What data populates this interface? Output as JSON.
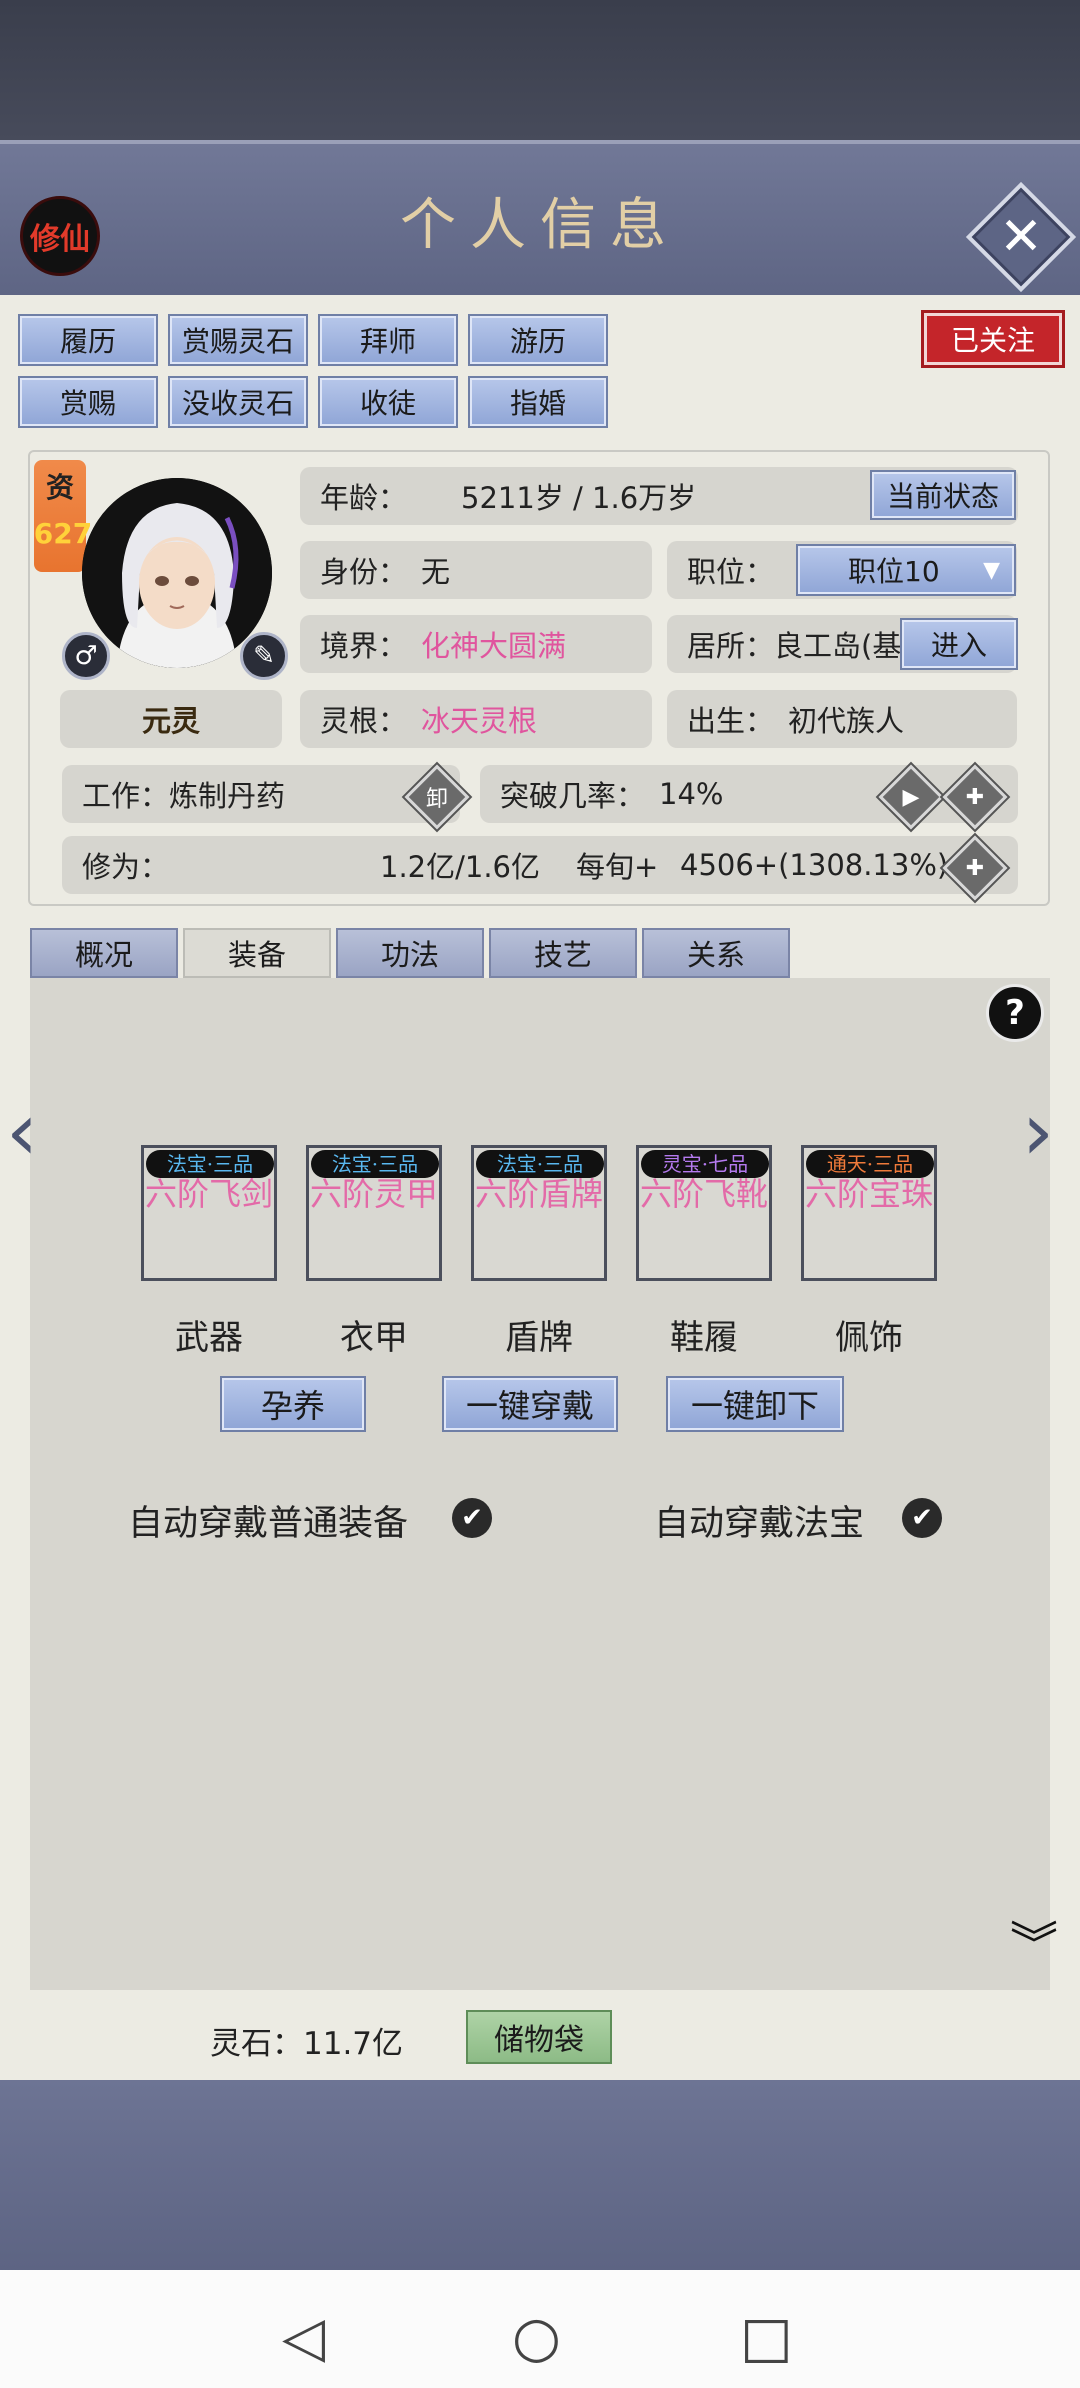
{
  "header": {
    "title": "个人信息",
    "badge": "修仙"
  },
  "actions": {
    "row1": [
      "履历",
      "赏赐灵石",
      "拜师",
      "游历"
    ],
    "row2": [
      "赏赐",
      "没收灵石",
      "收徒",
      "指婚"
    ],
    "follow": "已关注"
  },
  "profile": {
    "aptitude_label": "资",
    "aptitude_value": "627",
    "name": "元灵",
    "age_label": "年龄：",
    "age_value": "5211岁 / 1.6万岁",
    "current_state_btn": "当前状态",
    "identity_label": "身份：",
    "identity_value": "无",
    "position_label": "职位：",
    "position_value": "职位10",
    "realm_label": "境界：",
    "realm_value": "化神大圆满",
    "residence_label": "居所：",
    "residence_value": "良工岛(基",
    "enter_btn": "进入",
    "root_label": "灵根：",
    "root_value": "冰天灵根",
    "birth_label": "出生：",
    "birth_value": "初代族人",
    "work_label": "工作：",
    "work_value": "炼制丹药",
    "unload_icon_text": "卸",
    "breakthrough_label": "突破几率：",
    "breakthrough_value": "14%",
    "cultivation_label": "修为：",
    "cultivation_value": "1.2亿/1.6亿",
    "per_turn_label": "每旬+",
    "per_turn_value": "4506+(1308.13%)"
  },
  "tabs": [
    "概况",
    "装备",
    "功法",
    "技艺",
    "关系"
  ],
  "active_tab": "装备",
  "equipment": {
    "slots": [
      {
        "tag": "法宝·三品",
        "name": "六阶飞剑",
        "label": "武器",
        "tag_color": "#59b8f0"
      },
      {
        "tag": "法宝·三品",
        "name": "六阶灵甲",
        "label": "衣甲",
        "tag_color": "#59b8f0"
      },
      {
        "tag": "法宝·三品",
        "name": "六阶盾牌",
        "label": "盾牌",
        "tag_color": "#59b8f0"
      },
      {
        "tag": "灵宝·七品",
        "name": "六阶飞靴",
        "label": "鞋履",
        "tag_color": "#b57af0"
      },
      {
        "tag": "通天·三品",
        "name": "六阶宝珠",
        "label": "佩饰",
        "tag_color": "#f07a3a"
      }
    ],
    "buttons": [
      "孕养",
      "一键穿戴",
      "一键卸下"
    ],
    "auto_normal": "自动穿戴普通装备",
    "auto_treasure": "自动穿戴法宝"
  },
  "footer": {
    "spirit_stone_label": "灵石：",
    "spirit_stone_value": "11.7亿",
    "storage_btn": "储物袋"
  }
}
